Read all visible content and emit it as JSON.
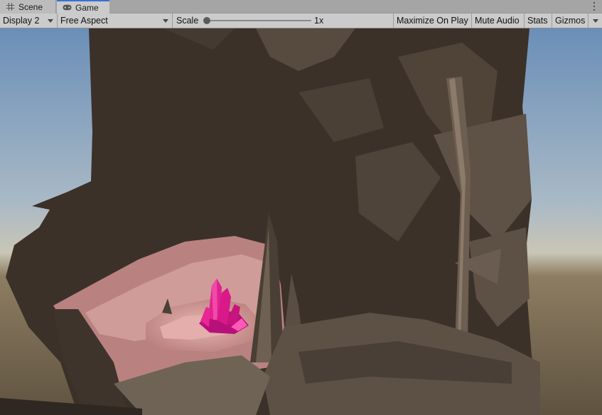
{
  "tabs": [
    {
      "label": "Scene",
      "icon": "grid-icon",
      "active": false
    },
    {
      "label": "Game",
      "icon": "gamepad-icon",
      "active": true
    }
  ],
  "toolbar": {
    "display": "Display 2",
    "aspect": "Free Aspect",
    "scale_label": "Scale",
    "scale_value": "1x",
    "scale_fraction": 0.0,
    "maximize_on_play": "Maximize On Play",
    "mute_audio": "Mute Audio",
    "stats": "Stats",
    "gizmos": "Gizmos"
  },
  "colors": {
    "sky_top": "#6a8fb7",
    "horizon": "#c9c6b6",
    "ground": "#6f6146",
    "rock_dark": "#3a3028",
    "rock_mid": "#5a4e43",
    "cave_pink": "#d9a1a0",
    "crystal": "#e21a92",
    "active_tab_accent": "#3a72d4"
  }
}
